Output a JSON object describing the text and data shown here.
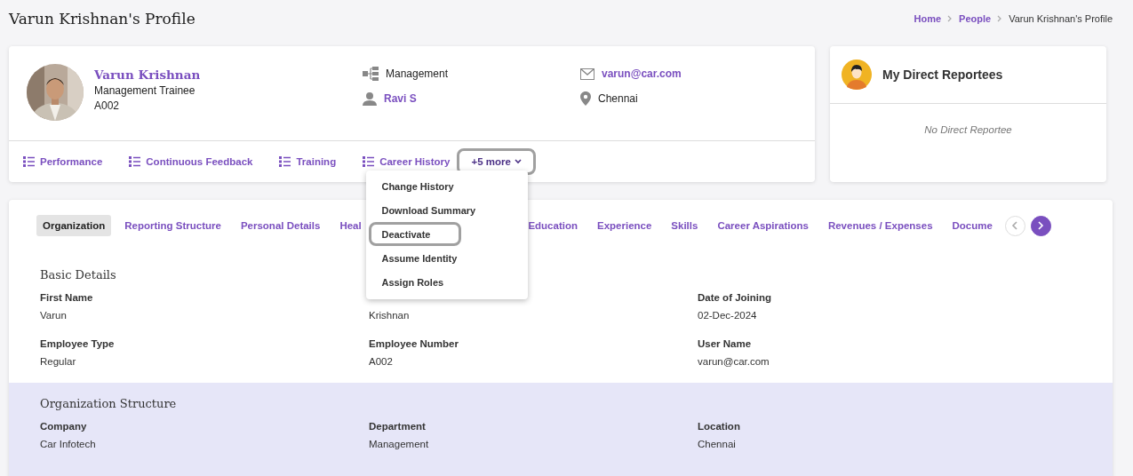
{
  "page": {
    "title": "Varun Krishnan's Profile"
  },
  "breadcrumb": [
    {
      "label": "Home",
      "link": true
    },
    {
      "label": "People",
      "link": true
    },
    {
      "label": "Varun Krishnan's Profile",
      "link": false
    }
  ],
  "profile": {
    "name": "Varun Krishnan",
    "designation": "Management Trainee",
    "employee_id": "A002",
    "details": [
      {
        "kind": "department",
        "text": "Management",
        "link": false
      },
      {
        "kind": "email",
        "text": "varun@car.com",
        "link": true
      },
      {
        "kind": "manager",
        "text": "Ravi S",
        "link": true
      },
      {
        "kind": "location",
        "text": "Chennai",
        "link": false
      }
    ],
    "actions": [
      {
        "label": "Performance"
      },
      {
        "label": "Continuous Feedback"
      },
      {
        "label": "Training"
      },
      {
        "label": "Career History"
      }
    ],
    "more": {
      "label": "+5 more",
      "expanded": true,
      "highlighted": true,
      "items": [
        {
          "label": "Change History",
          "highlighted": false
        },
        {
          "label": "Download Summary",
          "highlighted": false
        },
        {
          "label": "Deactivate",
          "highlighted": true
        },
        {
          "label": "Assume Identity",
          "highlighted": false
        },
        {
          "label": "Assign Roles",
          "highlighted": false
        }
      ]
    }
  },
  "reportees": {
    "title": "My Direct Reportees",
    "empty_text": "No Direct Reportee"
  },
  "tabs": [
    {
      "label": "Organization",
      "selected": true,
      "clipped": false
    },
    {
      "label": "Reporting Structure",
      "selected": false,
      "clipped": false
    },
    {
      "label": "Personal Details",
      "selected": false,
      "clipped": false
    },
    {
      "label": "Heal",
      "selected": false,
      "clipped": true
    },
    {
      "label": "Education",
      "selected": false,
      "clipped": false
    },
    {
      "label": "Experience",
      "selected": false,
      "clipped": false
    },
    {
      "label": "Skills",
      "selected": false,
      "clipped": false
    },
    {
      "label": "Career Aspirations",
      "selected": false,
      "clipped": false
    },
    {
      "label": "Revenues / Expenses",
      "selected": false,
      "clipped": false
    },
    {
      "label": "Docume",
      "selected": false,
      "clipped": false
    }
  ],
  "tab_scroll": [
    {
      "kind": "prev",
      "disabled": true
    },
    {
      "kind": "next",
      "disabled": false
    }
  ],
  "sections": [
    {
      "title": "Basic Details",
      "shaded": false,
      "fields": [
        {
          "label": "First Name",
          "value": "Varun"
        },
        {
          "value": "Krishnan"
        },
        {
          "label": "Date of Joining",
          "value": "02-Dec-2024"
        },
        {
          "label": "Employee Type",
          "value": "Regular"
        },
        {
          "label": "Employee Number",
          "value": "A002"
        },
        {
          "label": "User Name",
          "value": "varun@car.com"
        }
      ]
    },
    {
      "title": "Organization Structure",
      "shaded": true,
      "fields": [
        {
          "label": "Company",
          "value": "Car Infotech"
        },
        {
          "label": "Department",
          "value": "Management"
        },
        {
          "label": "Location",
          "value": "Chennai"
        }
      ]
    }
  ]
}
